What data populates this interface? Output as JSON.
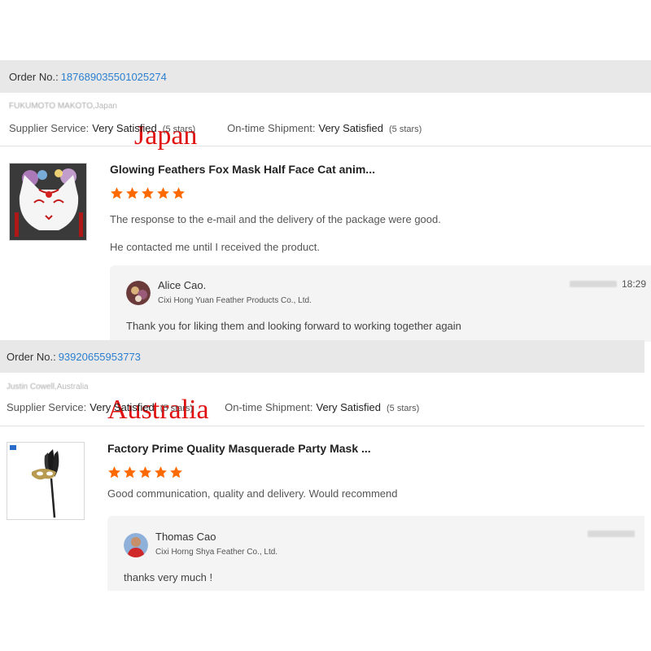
{
  "reviews": [
    {
      "order_label": "Order No.:",
      "order_number": "187689035501025274",
      "buyer_name": "FUKUMOTO MAKOTO",
      "buyer_country": "Japan",
      "country_annotation": "Japan",
      "supplier_service_label": "Supplier Service:",
      "supplier_service_rating": "Very Satisfied",
      "supplier_service_stars": "(5 stars)",
      "shipment_label": "On-time Shipment:",
      "shipment_rating": "Very Satisfied",
      "shipment_stars": "(5 stars)",
      "product_title": "Glowing Feathers Fox Mask Half Face Cat anim...",
      "stars": 5,
      "comments": [
        "The response to the e-mail and the delivery of the package were good.",
        "He contacted me until I received the product."
      ],
      "reply": {
        "name": "Alice Cao.",
        "company": "Cixi Hong Yuan Feather Products Co., Ltd.",
        "time": "18:29",
        "text": "Thank you for liking them and looking forward to working together again"
      }
    },
    {
      "order_label": "Order No.:",
      "order_number": "93920655953773",
      "buyer_name": "Justin Cowell",
      "buyer_country": "Australia",
      "country_annotation": "Australia",
      "supplier_service_label": "Supplier Service:",
      "supplier_service_rating": "Very Satisfied",
      "supplier_service_stars": "(5 stars)",
      "shipment_label": "On-time Shipment:",
      "shipment_rating": "Very Satisfied",
      "shipment_stars": "(5 stars)",
      "product_title": "Factory Prime Quality Masquerade Party Mask ...",
      "stars": 5,
      "comments": [
        "Good communication, quality and delivery. Would recommend"
      ],
      "reply": {
        "name": "Thomas Cao",
        "company": "Cixi Horng Shya Feather Co., Ltd.",
        "time": "",
        "text": "thanks very much !"
      }
    }
  ],
  "colors": {
    "order_bar_bg": "#e8e8e8",
    "order_number": "#2b7fd0",
    "star": "#ff6a00",
    "annotation": "#e01010",
    "reply_bg": "#f4f4f5"
  }
}
